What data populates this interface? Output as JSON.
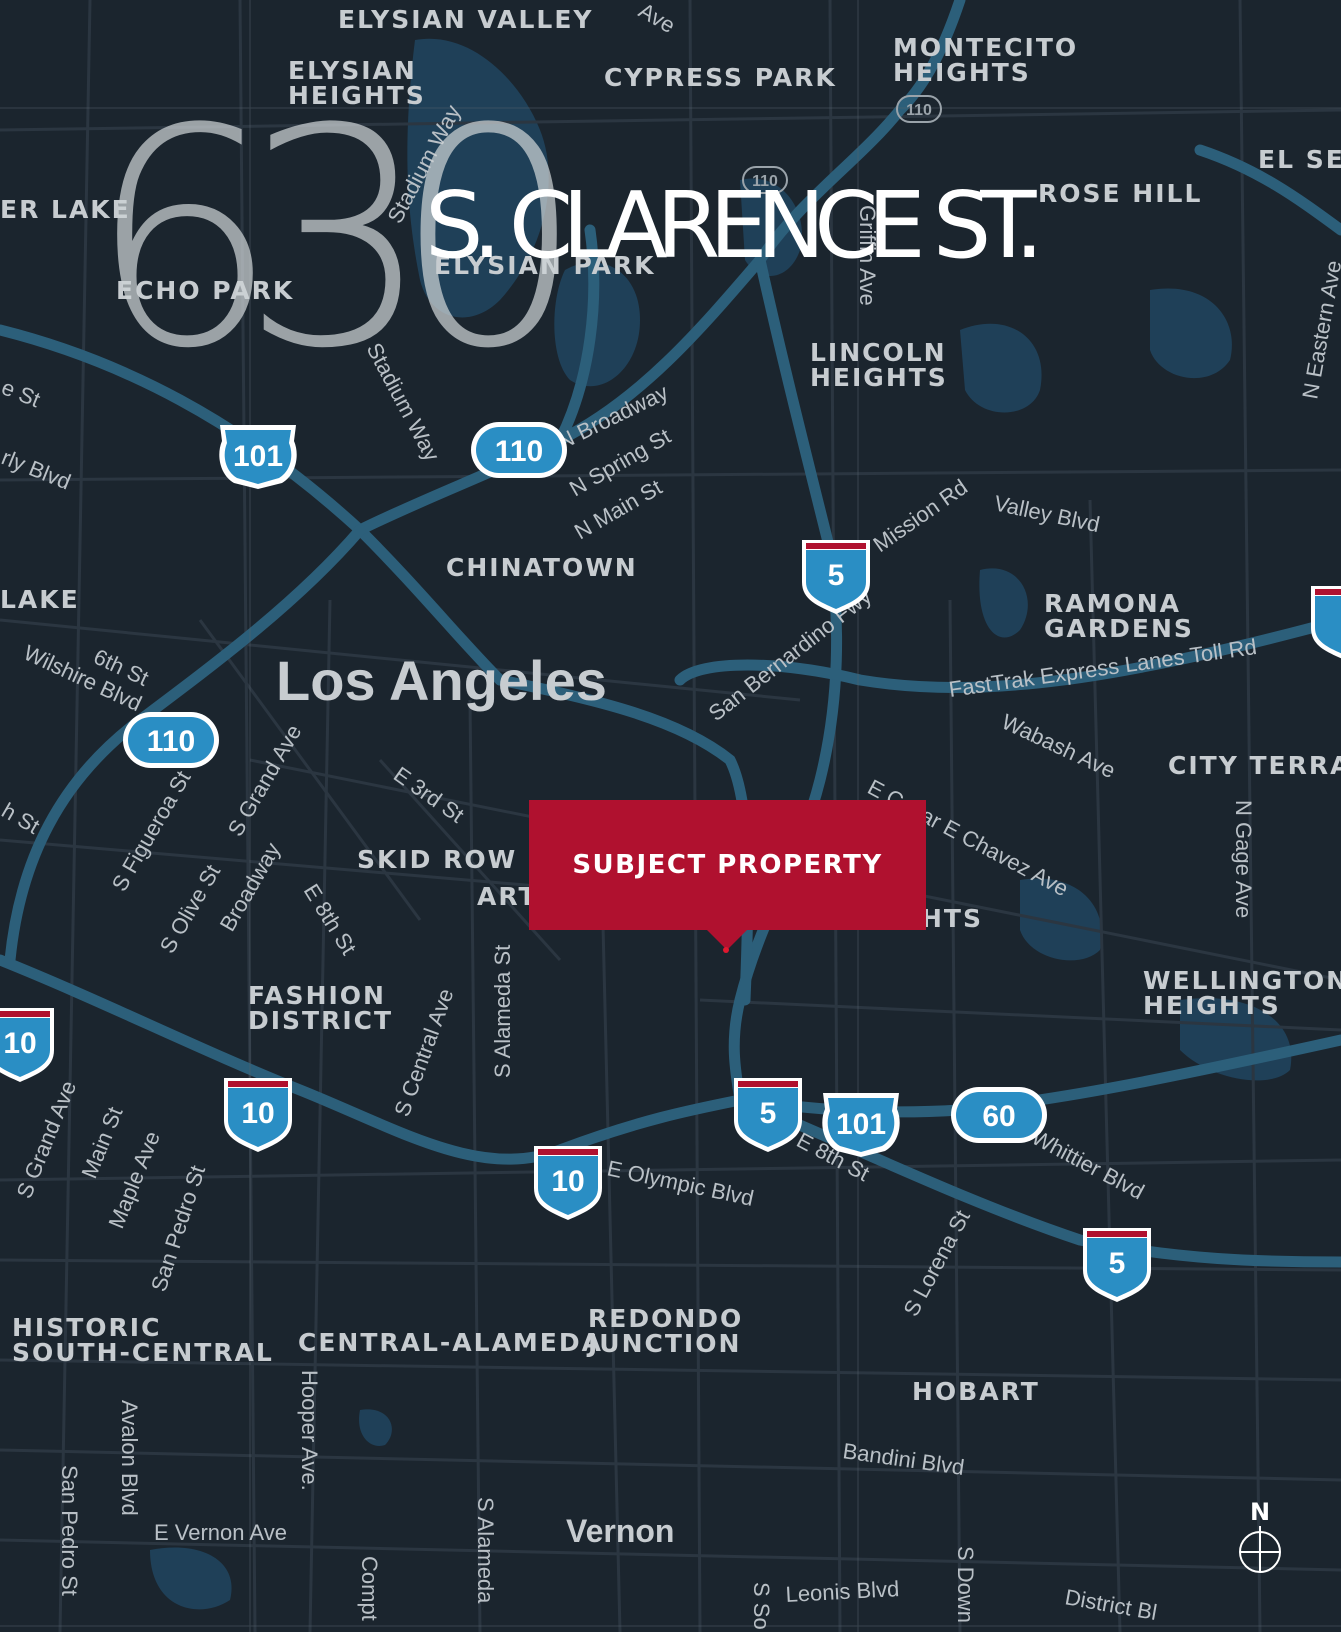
{
  "property": {
    "number": "630",
    "street": "S. CLARENCE ST."
  },
  "callout": {
    "label": "SUBJECT PROPERTY",
    "color": "#b0112f"
  },
  "compass": {
    "label": "N",
    "icon": "compass-icon"
  },
  "colors": {
    "background": "#1b252e",
    "freeway": "#2c5f7a",
    "water": "#1f4058",
    "label": "#c7ccd0",
    "shield": "#2a8ec4"
  },
  "map": {
    "neighborhoods": [
      {
        "id": "elysian-valley",
        "lines": [
          "ELYSIAN VALLEY"
        ]
      },
      {
        "id": "elysian-heights",
        "lines": [
          "ELYSIAN",
          "HEIGHTS"
        ]
      },
      {
        "id": "cypress-park",
        "lines": [
          "CYPRESS PARK"
        ]
      },
      {
        "id": "montecito-heights",
        "lines": [
          "MONTECITO",
          "HEIGHTS"
        ]
      },
      {
        "id": "el-sereno",
        "lines": [
          "EL SE"
        ]
      },
      {
        "id": "rose-hill",
        "lines": [
          "ROSE HILL"
        ]
      },
      {
        "id": "silver-lake",
        "lines": [
          "ER LAKE"
        ]
      },
      {
        "id": "echo-park",
        "lines": [
          "ECHO PARK"
        ]
      },
      {
        "id": "elysian-park",
        "lines": [
          "ELYSIAN PARK"
        ]
      },
      {
        "id": "lincoln-heights",
        "lines": [
          "LINCOLN",
          "HEIGHTS"
        ]
      },
      {
        "id": "chinatown",
        "lines": [
          "CHINATOWN"
        ]
      },
      {
        "id": "westlake",
        "lines": [
          "LAKE"
        ]
      },
      {
        "id": "ramona-gardens",
        "lines": [
          "RAMONA",
          "GARDENS"
        ]
      },
      {
        "id": "city-terrace",
        "lines": [
          "CITY TERRA"
        ]
      },
      {
        "id": "skid-row",
        "lines": [
          "SKID ROW"
        ]
      },
      {
        "id": "arts-district",
        "lines": [
          "ART"
        ]
      },
      {
        "id": "boyle-heights",
        "lines": [
          "HTS"
        ]
      },
      {
        "id": "wellington-heights",
        "lines": [
          "WELLINGTON",
          "HEIGHTS"
        ]
      },
      {
        "id": "fashion-district",
        "lines": [
          "FASHION",
          "DISTRICT"
        ]
      },
      {
        "id": "historic-south-central",
        "lines": [
          "HISTORIC",
          "SOUTH-CENTRAL"
        ]
      },
      {
        "id": "central-alameda",
        "lines": [
          "CENTRAL-ALAMEDA"
        ]
      },
      {
        "id": "redondo-junction",
        "lines": [
          "REDONDO",
          "JUNCTION"
        ]
      },
      {
        "id": "hobart",
        "lines": [
          "HOBART"
        ]
      }
    ],
    "cities": [
      {
        "id": "los-angeles",
        "text": "Los Angeles"
      },
      {
        "id": "vernon",
        "text": "Vernon"
      }
    ],
    "streets": [
      {
        "id": "stadium-way-1",
        "text": "Stadium Way"
      },
      {
        "id": "stadium-way-2",
        "text": "Stadium Way"
      },
      {
        "id": "avenue-top",
        "text": "Ave"
      },
      {
        "id": "griffin-ave",
        "text": "Griffin Ave"
      },
      {
        "id": "n-eastern-ave",
        "text": "N Eastern Ave"
      },
      {
        "id": "e-st-left",
        "text": "e St"
      },
      {
        "id": "rly-blvd",
        "text": "rly Blvd"
      },
      {
        "id": "broadway-n",
        "text": "N Broadway"
      },
      {
        "id": "n-spring-st",
        "text": "N Spring St"
      },
      {
        "id": "n-main-st",
        "text": "N Main St"
      },
      {
        "id": "mission-rd",
        "text": "Mission Rd"
      },
      {
        "id": "valley-blvd",
        "text": "Valley Blvd"
      },
      {
        "id": "6th-st",
        "text": "6th St"
      },
      {
        "id": "wilshire-blvd",
        "text": "Wilshire Blvd"
      },
      {
        "id": "san-bernardino-fwy",
        "text": "San Bernardino Fwy"
      },
      {
        "id": "fastrak",
        "text": "FastTrak Express Lanes Toll Rd"
      },
      {
        "id": "wabash-ave",
        "text": "Wabash Ave"
      },
      {
        "id": "s-grand-ave-1",
        "text": "S Grand Ave"
      },
      {
        "id": "e-3rd-st",
        "text": "E 3rd St"
      },
      {
        "id": "e-cesar-chavez",
        "text": "E Cesar E Chavez Ave"
      },
      {
        "id": "h-st",
        "text": "h St"
      },
      {
        "id": "s-figueroa-st",
        "text": "S Figueroa St"
      },
      {
        "id": "s-olive-st",
        "text": "S Olive St"
      },
      {
        "id": "broadway-s",
        "text": "Broadway"
      },
      {
        "id": "e-8th-st-1",
        "text": "E 8th St"
      },
      {
        "id": "n-gage-ave",
        "text": "N Gage Ave"
      },
      {
        "id": "s-alameda-st-1",
        "text": "S Alameda St"
      },
      {
        "id": "s-central-ave",
        "text": "S Central Ave"
      },
      {
        "id": "s-grand-ave-2",
        "text": "S Grand Ave"
      },
      {
        "id": "main-st",
        "text": "Main St"
      },
      {
        "id": "maple-ave",
        "text": "Maple Ave"
      },
      {
        "id": "san-pedro-st-1",
        "text": "San Pedro St"
      },
      {
        "id": "e-olympic-blvd",
        "text": "E Olympic Blvd"
      },
      {
        "id": "e-8th-st-2",
        "text": "E 8th St"
      },
      {
        "id": "whittier-blvd",
        "text": "Whittier Blvd"
      },
      {
        "id": "s-lorena-st",
        "text": "S Lorena St"
      },
      {
        "id": "hooper-ave",
        "text": "Hooper Ave."
      },
      {
        "id": "avalon-blvd",
        "text": "Avalon Blvd"
      },
      {
        "id": "san-pedro-st-2",
        "text": "San Pedro St"
      },
      {
        "id": "e-vernon-ave",
        "text": "E Vernon Ave"
      },
      {
        "id": "compton",
        "text": "Compt"
      },
      {
        "id": "s-alameda-st-2",
        "text": "S Alameda"
      },
      {
        "id": "bandini-blvd",
        "text": "Bandini Blvd"
      },
      {
        "id": "s-soto",
        "text": "S So"
      },
      {
        "id": "leonis-blvd",
        "text": "Leonis Blvd"
      },
      {
        "id": "s-downey",
        "text": "S Down"
      },
      {
        "id": "district-blvd",
        "text": "District Bl"
      }
    ],
    "shields": [
      {
        "id": "us-101-a",
        "type": "us",
        "number": "101"
      },
      {
        "id": "ca-110-a",
        "type": "ca",
        "number": "110"
      },
      {
        "id": "ca-110-small-a",
        "type": "small",
        "number": "110"
      },
      {
        "id": "ca-110-small-b",
        "type": "small",
        "number": "110"
      },
      {
        "id": "i-5-a",
        "type": "i",
        "number": "5"
      },
      {
        "id": "ca-110-b",
        "type": "ca",
        "number": "110"
      },
      {
        "id": "i-10-a",
        "type": "i",
        "number": "10"
      },
      {
        "id": "i-10-b",
        "type": "i",
        "number": "10"
      },
      {
        "id": "i-5-b",
        "type": "i",
        "number": "5"
      },
      {
        "id": "us-101-b",
        "type": "us",
        "number": "101"
      },
      {
        "id": "ca-60",
        "type": "ca",
        "number": "60"
      },
      {
        "id": "i-10-c",
        "type": "i",
        "number": "10"
      },
      {
        "id": "i-5-c",
        "type": "i",
        "number": "5"
      },
      {
        "id": "i-edge",
        "type": "i",
        "number": ""
      }
    ]
  }
}
